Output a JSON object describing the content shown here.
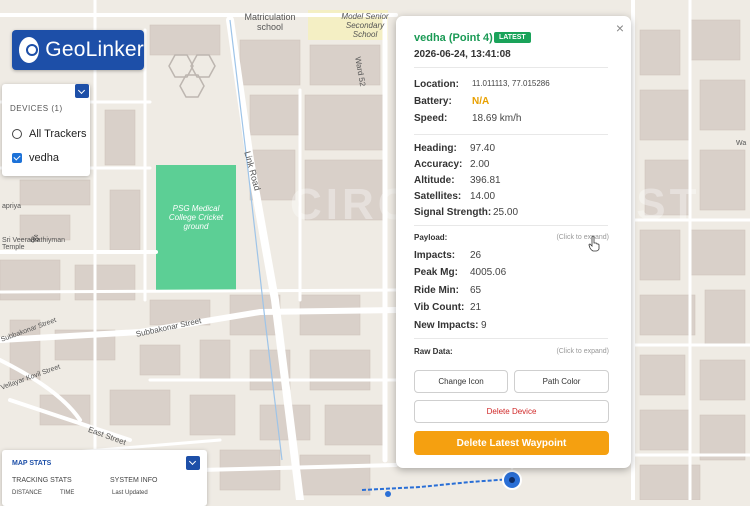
{
  "app": {
    "name": "GeoLinker"
  },
  "map": {
    "labels": {
      "matriculation": "Matriculation school",
      "model_senior": "Model Senior Secondary School",
      "ward": "Ward 52",
      "link_road": "Link Road",
      "cricket": "PSG Medical College Cricket ground",
      "temple": "Sri Veeramathiyman Temple",
      "apriya": "apriya",
      "subbakonar_left": "Subbakonar Street",
      "subbakonar_mid": "Subbakonar Street",
      "kovil": "Vellayar Kovil Street",
      "east": "East Street",
      "right_edge": "Wa"
    },
    "watermark": "CIRCUIT DIGEST",
    "colors": {
      "park": "#5ccf95",
      "road": "#ffffff",
      "building": "#d9d0c9",
      "route": "#2a6fd6"
    }
  },
  "devices": {
    "title": "DEVICES (1)",
    "items": [
      {
        "label": "All Trackers",
        "selected": false
      },
      {
        "label": "vedha",
        "selected": true
      }
    ]
  },
  "map_stats": {
    "title": "MAP STATS",
    "tracking_title": "TRACKING STATS",
    "system_title": "SYSTEM INFO",
    "distance_label": "DISTANCE",
    "time_label": "TIME",
    "last_updated": "Last Updated"
  },
  "popup": {
    "close": "×",
    "title": "vedha (Point 4)",
    "badge": "LATEST",
    "datetime": "2026-06-24, 13:41:08",
    "location_label": "Location:",
    "location_value": "11.011113, 77.015286",
    "battery_label": "Battery:",
    "battery_value": "N/A",
    "speed_label": "Speed:",
    "speed_value": "18.69 km/h",
    "heading_label": "Heading:",
    "heading_value": "97.40",
    "accuracy_label": "Accuracy:",
    "accuracy_value": "2.00",
    "altitude_label": "Altitude:",
    "altitude_value": "396.81",
    "satellites_label": "Satellites:",
    "satellites_value": "14.00",
    "signal_label": "Signal Strength:",
    "signal_value": "25.00",
    "payload_label": "Payload:",
    "payload_hint": "(Click to expand)",
    "impacts_label": "Impacts:",
    "impacts_value": "26",
    "peak_label": "Peak Mg:",
    "peak_value": "4005.06",
    "ride_label": "Ride Min:",
    "ride_value": "65",
    "vib_label": "Vib Count:",
    "vib_value": "21",
    "new_impacts_label": "New Impacts:",
    "new_impacts_value": "9",
    "raw_label": "Raw Data:",
    "raw_hint": "(Click to expand)",
    "btn_change_icon": "Change Icon",
    "btn_path_color": "Path Color",
    "btn_delete_device": "Delete Device",
    "btn_delete_waypoint": "Delete Latest Waypoint"
  },
  "colors": {
    "brand": "#1d4fa8",
    "accent": "#f5a010",
    "success": "#1a9a55",
    "danger": "#d02828",
    "battery": "#e8a000"
  }
}
